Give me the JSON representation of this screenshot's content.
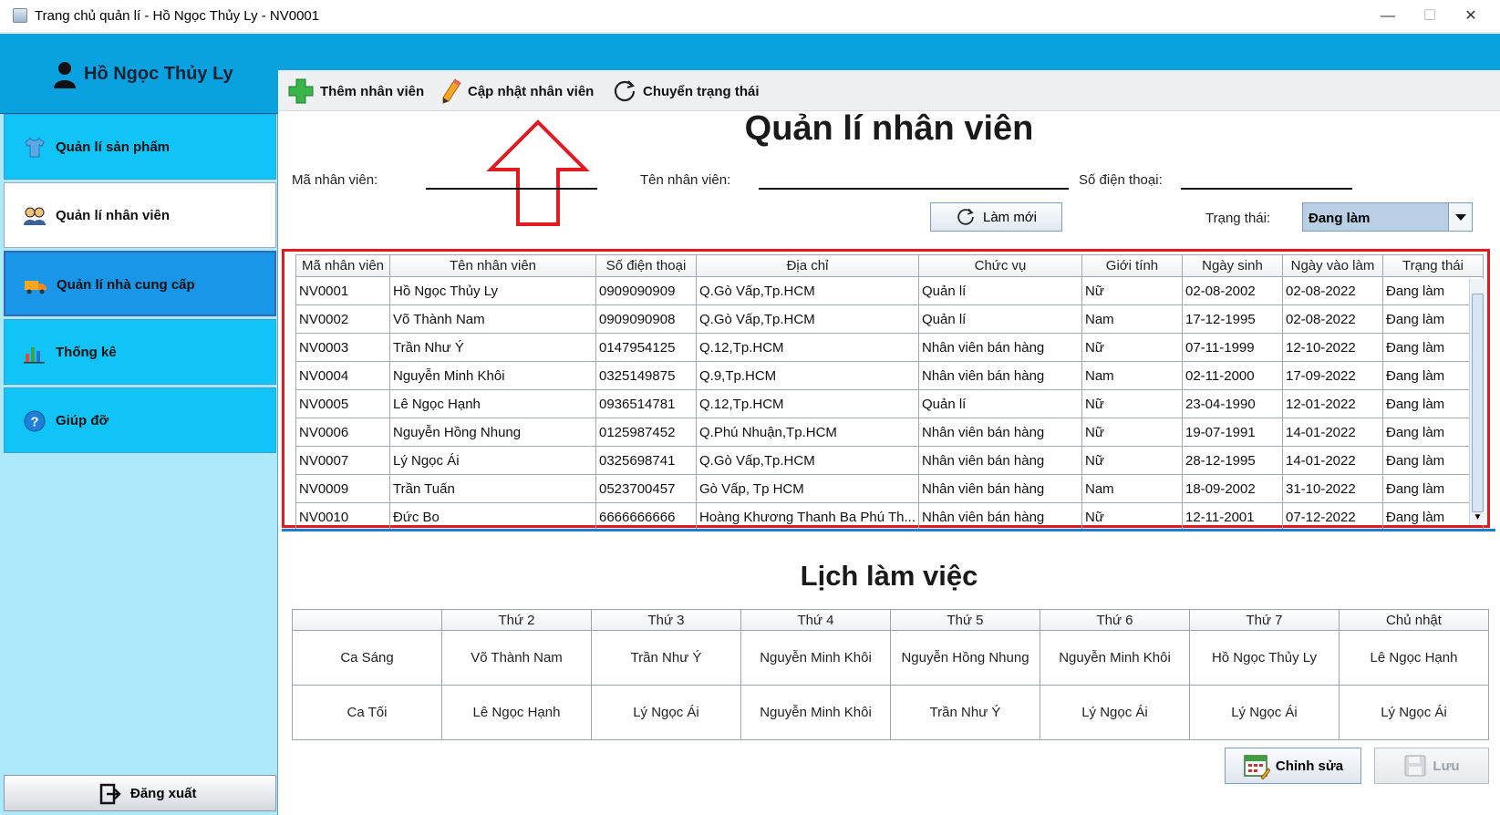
{
  "window": {
    "title": "Trang chủ quản lí - Hồ Ngọc Thủy Ly - NV0001",
    "minimize": "—",
    "maximize": "☐",
    "close": "✕"
  },
  "user": {
    "name": "Hồ Ngọc Thủy Ly",
    "icon": "user-icon"
  },
  "sidebar": {
    "items": [
      {
        "label": "Quản lí sản phẩm",
        "icon": "shirt-icon"
      },
      {
        "label": "Quản lí nhân viên",
        "icon": "staff-icon"
      },
      {
        "label": "Quản lí nhà cung cấp",
        "icon": "truck-icon"
      },
      {
        "label": "Thống kê",
        "icon": "bar-chart-icon"
      },
      {
        "label": "Giúp đỡ",
        "icon": "help-icon"
      }
    ],
    "logout": "Đăng xuất"
  },
  "toolbar": {
    "add": "Thêm nhân viên",
    "update": "Cập nhật nhân viên",
    "toggle_status": "Chuyển trạng thái"
  },
  "heading": "Quản lí nhân viên",
  "filters": {
    "id_label": "Mã nhân viên:",
    "id_value": "",
    "name_label": "Tên nhân viên:",
    "name_value": "",
    "phone_label": "Số điện thoại:",
    "phone_value": "",
    "refresh": "Làm mới",
    "status_label": "Trạng thái:",
    "status_value": "Đang làm"
  },
  "employees": {
    "columns": [
      "Mã nhân viên",
      "Tên nhân viên",
      "Số điện thoại",
      "Địa chỉ",
      "Chức vụ",
      "Giới tính",
      "Ngày sinh",
      "Ngày vào làm",
      "Trạng thái"
    ],
    "rows": [
      [
        "NV0001",
        "Hồ Ngọc Thủy Ly",
        "0909090909",
        "Q.Gò Vấp,Tp.HCM",
        "Quản lí",
        "Nữ",
        "02-08-2002",
        "02-08-2022",
        "Đang làm"
      ],
      [
        "NV0002",
        "Võ Thành Nam",
        "0909090908",
        "Q.Gò Vấp,Tp.HCM",
        "Quản lí",
        "Nam",
        "17-12-1995",
        "02-08-2022",
        "Đang làm"
      ],
      [
        "NV0003",
        "Trần Như Ý",
        "0147954125",
        "Q.12,Tp.HCM",
        "Nhân viên bán hàng",
        "Nữ",
        "07-11-1999",
        "12-10-2022",
        "Đang làm"
      ],
      [
        "NV0004",
        "Nguyễn Minh Khôi",
        "0325149875",
        "Q.9,Tp.HCM",
        "Nhân viên bán hàng",
        "Nam",
        "02-11-2000",
        "17-09-2022",
        "Đang làm"
      ],
      [
        "NV0005",
        "Lê Ngọc Hạnh",
        "0936514781",
        "Q.12,Tp.HCM",
        "Quản lí",
        "Nữ",
        "23-04-1990",
        "12-01-2022",
        "Đang làm"
      ],
      [
        "NV0006",
        "Nguyễn Hồng Nhung",
        "0125987452",
        "Q.Phú Nhuận,Tp.HCM",
        "Nhân viên bán hàng",
        "Nữ",
        "19-07-1991",
        "14-01-2022",
        "Đang làm"
      ],
      [
        "NV0007",
        "Lý Ngọc Ái",
        "0325698741",
        "Q.Gò Vấp,Tp.HCM",
        "Nhân viên bán hàng",
        "Nữ",
        "28-12-1995",
        "14-01-2022",
        "Đang làm"
      ],
      [
        "NV0009",
        "Trần Tuấn",
        "0523700457",
        "Gò Vấp, Tp HCM",
        "Nhân viên bán hàng",
        "Nam",
        "18-09-2002",
        "31-10-2022",
        "Đang làm"
      ],
      [
        "NV0010",
        "Đức Bo",
        "6666666666",
        "Hoàng Khương Thanh Ba Phú Th...",
        "Nhân viên bán hàng",
        "Nữ",
        "12-11-2001",
        "07-12-2022",
        "Đang làm"
      ]
    ]
  },
  "schedule": {
    "heading": "Lịch làm việc",
    "columns": [
      "",
      "Thứ 2",
      "Thứ 3",
      "Thứ 4",
      "Thứ 5",
      "Thứ 6",
      "Thứ 7",
      "Chủ nhật"
    ],
    "rows": [
      [
        "Ca Sáng",
        "Võ Thành Nam",
        "Trần Như Ý",
        "Nguyễn Minh Khôi",
        "Nguyễn Hồng Nhung",
        "Nguyễn Minh Khôi",
        "Hồ Ngọc Thủy Ly",
        "Lê Ngọc Hạnh"
      ],
      [
        "Ca Tối",
        "Lê Ngọc Hạnh",
        "Lý Ngọc Ái",
        "Nguyễn Minh Khôi",
        "Trần Như Ý",
        "Lý Ngọc Ái",
        "Lý Ngọc Ái",
        "Lý Ngọc Ái"
      ]
    ],
    "edit": "Chỉnh sửa",
    "save": "Lưu"
  },
  "colors": {
    "accent": "#0aa1e0",
    "sidebar_item": "#11c4f7",
    "sidebar_bg": "#aee9fb",
    "highlight": "#e21a22"
  }
}
